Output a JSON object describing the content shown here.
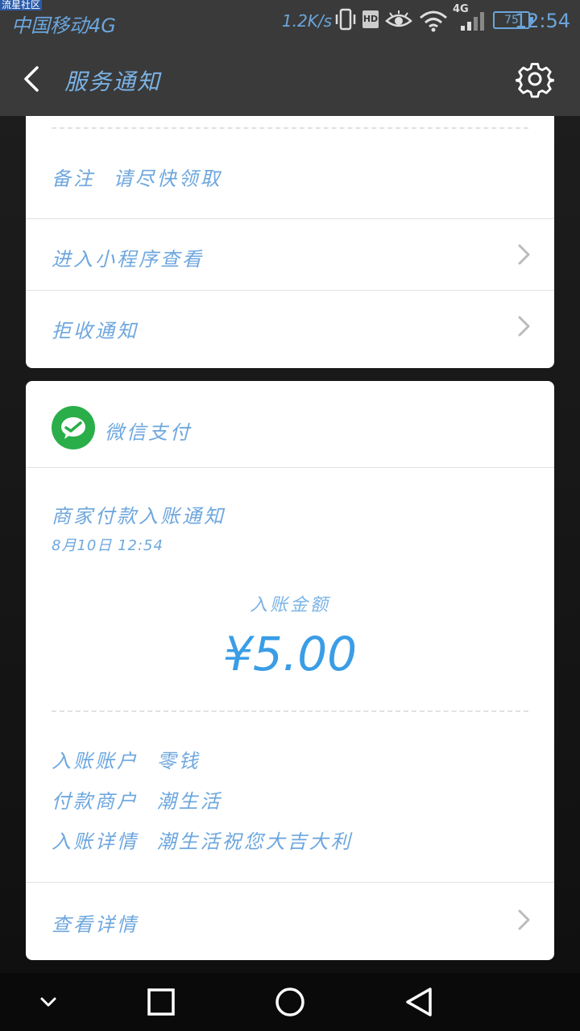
{
  "watermark": "流星社区",
  "status_bar": {
    "carrier": "中国移动4G",
    "speed": "1.2K/s",
    "hd_label": "HD",
    "network_label": "4G",
    "battery_level": "75",
    "time": "12:54"
  },
  "nav": {
    "title": "服务通知"
  },
  "card1": {
    "note_label": "备注",
    "note_value": "请尽快领取",
    "enter_miniprogram": "进入小程序查看",
    "reject_notification": "拒收通知"
  },
  "card2": {
    "brand": "微信支付",
    "notice_title": "商家付款入账通知",
    "notice_time": "8月10日  12:54",
    "amount_label": "入账金额",
    "amount": "¥5.00",
    "details": [
      {
        "label": "入账账户",
        "value": "零钱"
      },
      {
        "label": "付款商户",
        "value": "潮生活"
      },
      {
        "label": "入账详情",
        "value": "潮生活祝您大吉大利"
      }
    ],
    "view_details": "查看详情"
  },
  "colors": {
    "accent_text": "#6ea7de",
    "amount": "#3a9de6",
    "wechat_green": "#2aae49",
    "bar_background": "#3a3a3a"
  },
  "icons": {
    "back": "chevron-left-icon",
    "settings": "gear-icon",
    "row_arrow": "chevron-right-icon",
    "wechat_pay": "wechat-pay-icon",
    "nav_down": "chevron-down-icon",
    "nav_recent": "square-icon",
    "nav_home": "circle-icon",
    "nav_back": "triangle-back-icon"
  }
}
